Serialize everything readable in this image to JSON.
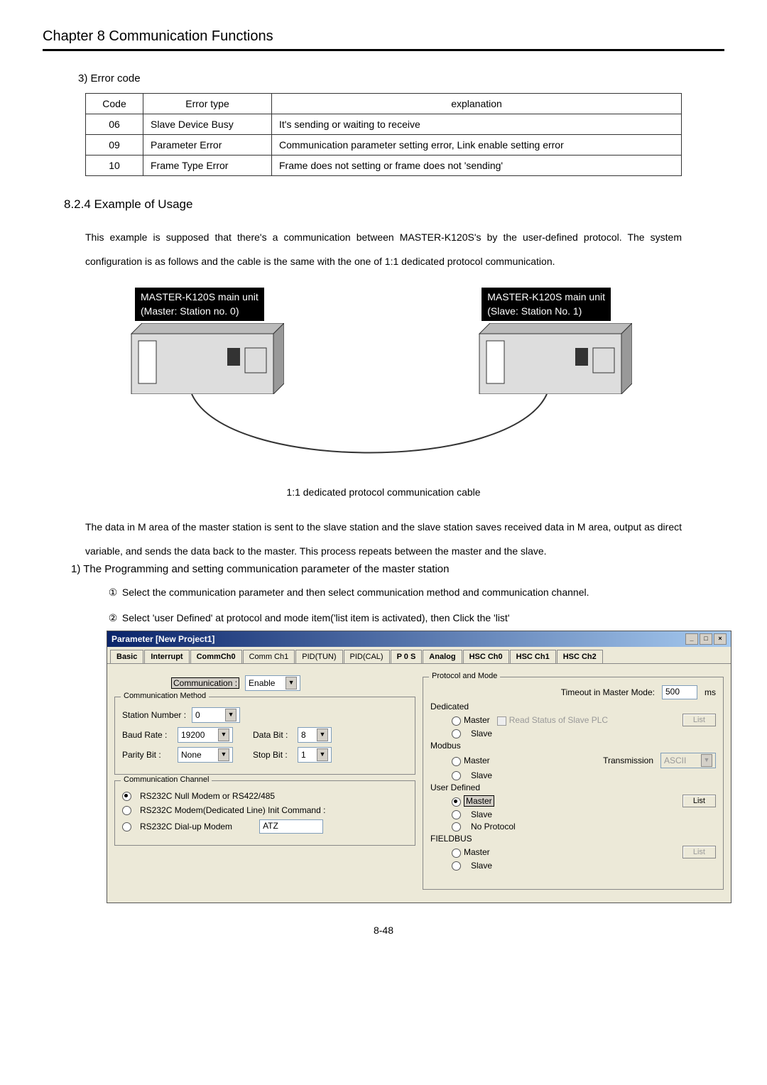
{
  "chapter_title": "Chapter 8   Communication Functions",
  "subhead_error": "3) Error code",
  "error_table": {
    "headers": {
      "code": "Code",
      "type": "Error type",
      "expl": "explanation"
    },
    "rows": [
      {
        "code": "06",
        "type": "Slave Device Busy",
        "expl": "It's sending or waiting to receive"
      },
      {
        "code": "09",
        "type": "Parameter Error",
        "expl": "Communication parameter setting error, Link enable setting error"
      },
      {
        "code": "10",
        "type": "Frame Type Error",
        "expl": "Frame does not setting or frame does not 'sending'"
      }
    ]
  },
  "section_title": "8.2.4 Example of Usage",
  "body_paragraph": "This example is supposed that there's a communication between MASTER-K120S's by the user-defined protocol. The system configuration is as follows and the cable is the same with the one of 1:1 dedicated protocol communication.",
  "diagram": {
    "left_label_l1": "MASTER-K120S main unit",
    "left_label_l2": "(Master: Station no. 0)",
    "right_label_l1": "MASTER-K120S main unit",
    "right_label_l2": "(Slave: Station No. 1)",
    "caption": "1:1 dedicated protocol communication cable"
  },
  "body_paragraph2": "The data in M area of the master station is sent to the slave station and the slave station saves received data in M area, output as direct variable, and sends the data back to the master. This process repeats between the master and the slave.",
  "subhead_prog": "1) The Programming and setting communication parameter of the master station",
  "step1": "Select the communication parameter and then select communication method and communication channel.",
  "step2": "Select 'user Defined' at protocol and mode item('list item is activated), then Click the 'list'",
  "circ1": "①",
  "circ2": "②",
  "dialog": {
    "title": "Parameter [New Project1]",
    "tabs": [
      "Basic",
      "Interrupt",
      "CommCh0",
      "Comm Ch1",
      "PID(TUN)",
      "PID(CAL)",
      "P 0 S",
      "Analog",
      "HSC Ch0",
      "HSC Ch1",
      "HSC Ch2"
    ],
    "communication_label": "Communication :",
    "communication_value": "Enable",
    "g_comm_method": "Communication Method",
    "station_label": "Station Number :",
    "station_value": "0",
    "baud_label": "Baud Rate :",
    "baud_value": "19200",
    "data_label": "Data Bit :",
    "data_value": "8",
    "parity_label": "Parity Bit :",
    "parity_value": "None",
    "stop_label": "Stop Bit :",
    "stop_value": "1",
    "g_comm_channel": "Communication Channel",
    "ch_opt1": "RS232C Null Modem or RS422/485",
    "ch_opt2": "RS232C Modem(Dedicated Line)   Init Command :",
    "ch_opt3": "RS232C Dial-up Modem",
    "init_cmd": "ATZ",
    "g_protocol": "Protocol and Mode",
    "timeout_label": "Timeout in Master Mode:",
    "timeout_value": "500",
    "timeout_unit": "ms",
    "dedicated": "Dedicated",
    "master": "Master",
    "slave": "Slave",
    "read_status": "Read Status of Slave PLC",
    "list": "List",
    "modbus": "Modbus",
    "transmission": "Transmission",
    "ascii": "ASCII",
    "user_defined": "User Defined",
    "no_protocol": "No Protocol",
    "fieldbus": "FIELDBUS"
  },
  "footer": "8-48"
}
